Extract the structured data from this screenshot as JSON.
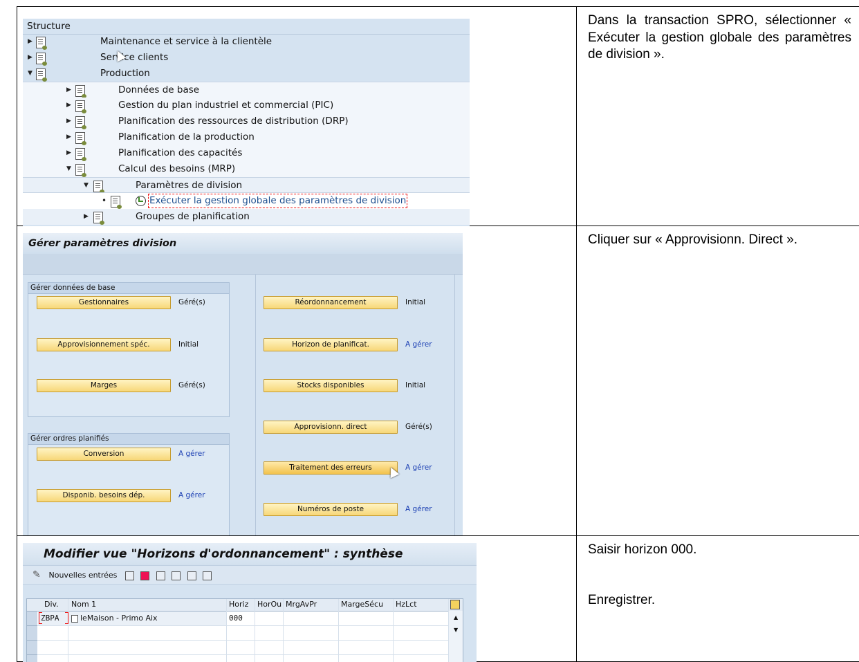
{
  "steps": [
    {
      "text": "Dans la transaction SPRO, sélectionner « Exécuter la gestion globale des paramètres de division »."
    },
    {
      "text": "Cliquer sur « Approvisionn. Direct »."
    },
    {
      "text1": "Saisir horizon 000.",
      "text2": "Enregistrer."
    }
  ],
  "spro": {
    "header": "Structure",
    "items": [
      {
        "label": "Maintenance et service à la clientèle"
      },
      {
        "label": "Service clients"
      },
      {
        "label": "Production"
      },
      {
        "label": "Données de base"
      },
      {
        "label": "Gestion du plan industriel et commercial (PIC)"
      },
      {
        "label": "Planification des ressources de distribution (DRP)"
      },
      {
        "label": "Planification de la production"
      },
      {
        "label": "Planification des capacités"
      },
      {
        "label": "Calcul des besoins (MRP)"
      },
      {
        "label": "Paramètres de division"
      },
      {
        "label": "Exécuter la gestion globale des paramètres de division"
      },
      {
        "label": "Groupes de planification"
      }
    ]
  },
  "gerer": {
    "title": "Gérer paramètres division",
    "group1": "Gérer données de base",
    "group2": "Gérer ordres planifiés",
    "left_buttons": [
      {
        "label": "Gestionnaires",
        "status": "Géré(s)"
      },
      {
        "label": "Approvisionnement spéc.",
        "status": "Initial"
      },
      {
        "label": "Marges",
        "status": "Géré(s)"
      },
      {
        "label": "Conversion",
        "status": "A gérer"
      },
      {
        "label": "Disponib. besoins dép.",
        "status": "A gérer"
      }
    ],
    "right_buttons": [
      {
        "label": "Réordonnancement",
        "status": "Initial"
      },
      {
        "label": "Horizon de planificat.",
        "status": "A gérer"
      },
      {
        "label": "Stocks disponibles",
        "status": "Initial"
      },
      {
        "label": "Approvisionn. direct",
        "status": "Géré(s)"
      },
      {
        "label": "Traitement des erreurs",
        "status": "A gérer"
      },
      {
        "label": "Numéros de poste",
        "status": "A gérer"
      }
    ]
  },
  "modifier": {
    "title": "Modifier vue \"Horizons d'ordonnancement\" : synthèse",
    "toolbar_label": "Nouvelles entrées",
    "columns": [
      "Div.",
      "Nom 1",
      "Horiz",
      "HorOu",
      "MrgAvPr",
      "MargeSécu",
      "HzLct"
    ],
    "row": {
      "div": "ZBPA",
      "nom": "leMaison - Primo Aix",
      "horiz": "000"
    }
  }
}
